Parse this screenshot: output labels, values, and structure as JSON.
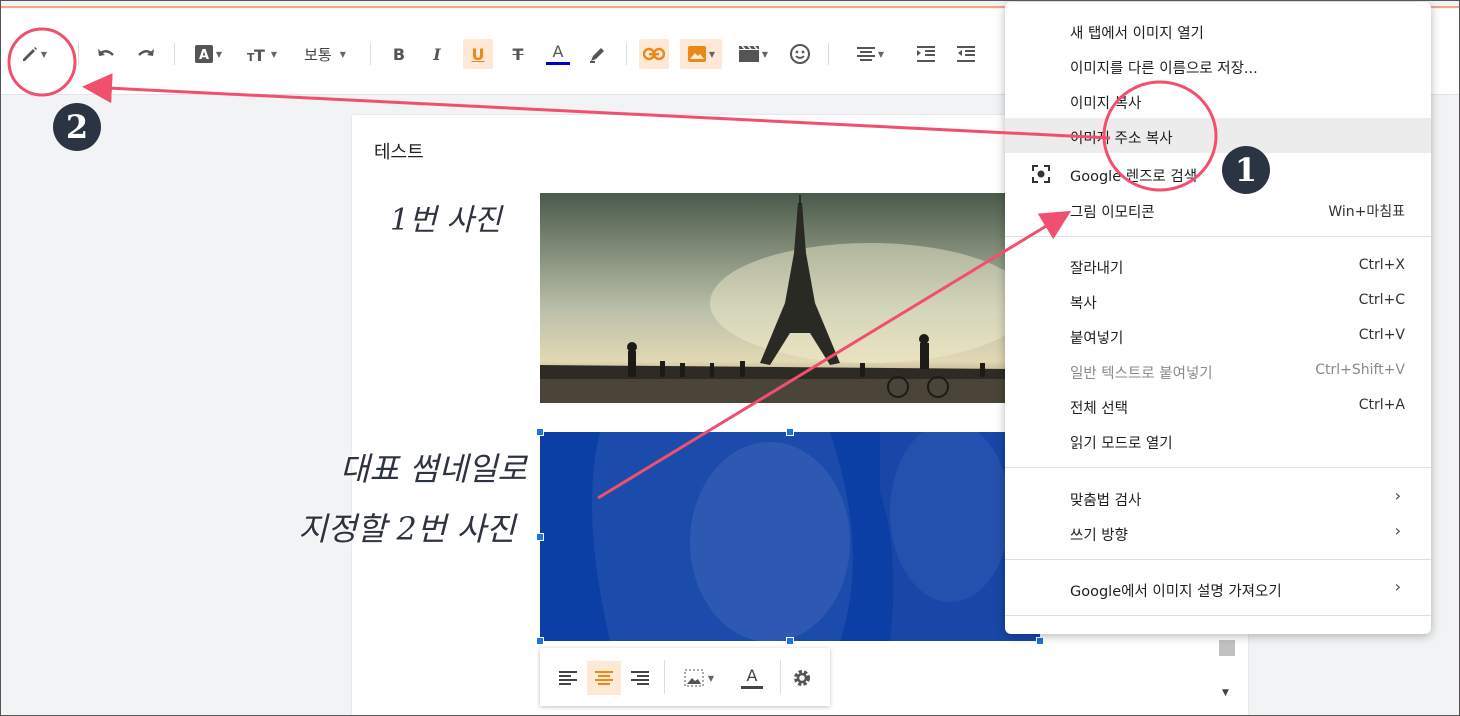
{
  "toolbar": {
    "font_size_label": "보통"
  },
  "document": {
    "title": "테스트",
    "caption1": "1번 사진",
    "caption2_line1": "대표 썸네일로",
    "caption2_line2": "지정할 2번 사진"
  },
  "context_menu": {
    "items": [
      {
        "label": "새 탭에서 이미지 열기",
        "shortcut": ""
      },
      {
        "label": "이미지를 다른 이름으로 저장...",
        "shortcut": ""
      },
      {
        "label": "이미지 복사",
        "shortcut": ""
      },
      {
        "label": "이미지 주소 복사",
        "shortcut": ""
      },
      {
        "label": "Google 렌즈로 검색",
        "shortcut": ""
      },
      {
        "label": "그림 이모티콘",
        "shortcut": "Win+마침표"
      },
      {
        "label": "잘라내기",
        "shortcut": "Ctrl+X"
      },
      {
        "label": "복사",
        "shortcut": "Ctrl+C"
      },
      {
        "label": "붙여넣기",
        "shortcut": "Ctrl+V"
      },
      {
        "label": "일반 텍스트로 붙여넣기",
        "shortcut": "Ctrl+Shift+V"
      },
      {
        "label": "전체 선택",
        "shortcut": "Ctrl+A"
      },
      {
        "label": "읽기 모드로 열기",
        "shortcut": ""
      },
      {
        "label": "맞춤법 검사",
        "shortcut": ""
      },
      {
        "label": "쓰기 방향",
        "shortcut": ""
      },
      {
        "label": "Google에서 이미지 설명 가져오기",
        "shortcut": ""
      }
    ]
  },
  "annotations": {
    "badge1": "1",
    "badge2": "2",
    "color": "#f0506e"
  },
  "icons": [
    "pencil-icon",
    "undo-icon",
    "redo-icon",
    "text-color-icon",
    "text-size-icon",
    "bold-icon",
    "italic-icon",
    "underline-icon",
    "strikethrough-icon",
    "font-color-icon",
    "highlight-icon",
    "link-icon",
    "image-icon",
    "video-icon",
    "emoji-icon",
    "align-icon",
    "indent-icon",
    "outdent-icon",
    "lens-icon",
    "settings-icon"
  ]
}
